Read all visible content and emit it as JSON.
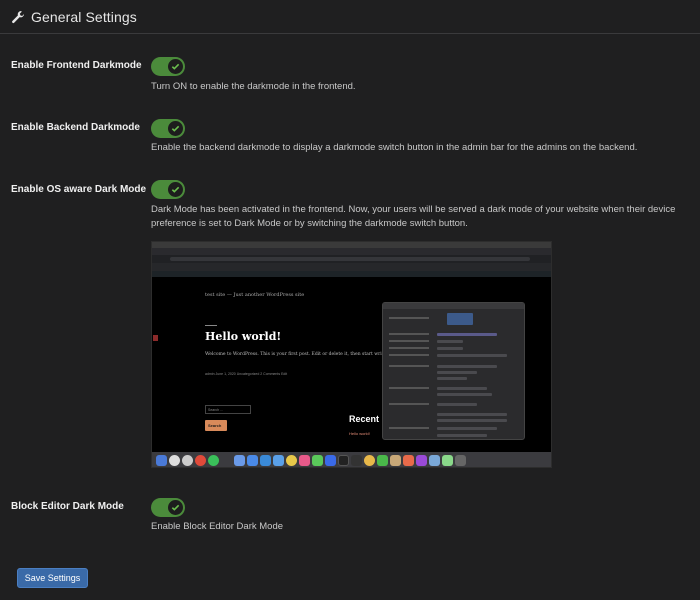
{
  "header": {
    "title": "General Settings",
    "icon": "wrench-icon"
  },
  "settings": [
    {
      "label": "Enable Frontend Darkmode",
      "description": "Turn ON to enable the darkmode in the frontend.",
      "enabled": true
    },
    {
      "label": "Enable Backend Darkmode",
      "description": "Enable the backend darkmode to display a darkmode switch button in the admin bar for the admins on the backend.",
      "enabled": true
    },
    {
      "label": "Enable OS aware Dark Mode",
      "description": "Dark Mode has been activated in the frontend. Now, your users will be served a dark mode of your website when their device preference is set to Dark Mode or by switching the darkmode switch button.",
      "enabled": true
    },
    {
      "label": "Block Editor Dark Mode",
      "description": "Enable Block Editor Dark Mode",
      "enabled": true
    }
  ],
  "preview": {
    "site_title": "test site — Just another WordPress site",
    "post_title": "Hello world!",
    "post_excerpt": "Welcome to WordPress. This is your first post. Edit or delete it, then start writing!",
    "post_meta": "admin   June 1, 2020   Uncategorized   2 Comments   Edit",
    "search_placeholder": "Search ...",
    "search_button": "Search",
    "recent_heading": "Recent",
    "recent_link": "Hello world!"
  },
  "save_button": "Save Settings",
  "colors": {
    "toggle_on": "#4b8b3b",
    "save_button": "#3a6aa8",
    "background": "#1f1f20"
  }
}
